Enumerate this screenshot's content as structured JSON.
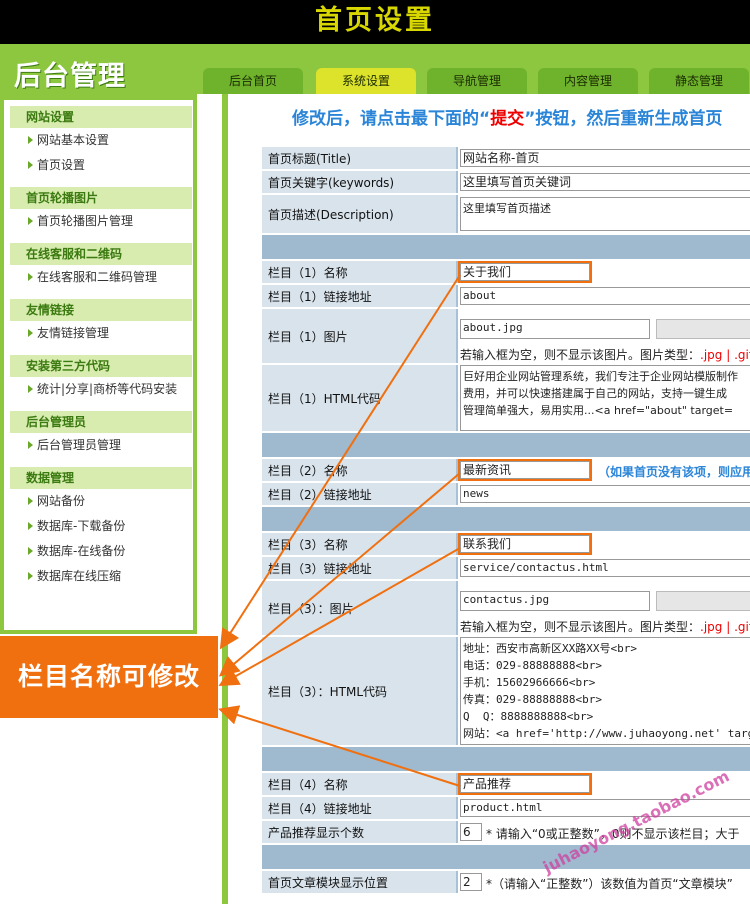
{
  "banner": "首页设置",
  "logo": "后台管理",
  "tabs": [
    "后台首页",
    "系统设置",
    "导航管理",
    "内容管理",
    "静态管理"
  ],
  "sidebar": {
    "g1": "网站设置",
    "g1i1": "网站基本设置",
    "g1i2": "首页设置",
    "g2": "首页轮播图片",
    "g2i1": "首页轮播图片管理",
    "g3": "在线客服和二维码",
    "g3i1": "在线客服和二维码管理",
    "g4": "友情链接",
    "g4i1": "友情链接管理",
    "g5": "安装第三方代码",
    "g5i1": "统计|分享|商桥等代码安装",
    "g6": "后台管理员",
    "g6i1": "后台管理员管理",
    "g7": "数据管理",
    "g7i1": "网站备份",
    "g7i2": "数据库-下载备份",
    "g7i3": "数据库-在线备份",
    "g7i4": "数据库在线压缩"
  },
  "callout": "栏目名称可修改",
  "notice": {
    "a": "修改后，请点击最下面的“",
    "b": "提交",
    "c": "”按钮，然后重新生成首页"
  },
  "form": {
    "title_l": "首页标题(Title)",
    "title_v": "网站名称-首页",
    "kw_l": "首页关键字(keywords)",
    "kw_v": "这里填写首页关键词",
    "desc_l": "首页描述(Description)",
    "desc_v": "这里填写首页描述",
    "c1n_l": "栏目（1）名称",
    "c1n_v": "关于我们",
    "c1u_l": "栏目（1）链接地址",
    "c1u_v": "about",
    "c1p_l": "栏目（1）图片",
    "c1p_v": "about.jpg",
    "imghint_a": "若输入框为空，则不显示该图片。图片类型：",
    "imghint_b": ".jpg | .gif",
    "c1h_l": "栏目（1）HTML代码",
    "c1h_v": "巨好用企业网站管理系统，我们专注于企业网站模版制作\n费用，并可以快速搭建属于自己的网站，支持一键生成\n管理简单强大，易用实用...<a href=\"about\" target=",
    "c2n_l": "栏目（2）名称",
    "c2n_v": "最新资讯",
    "c2n_hint": "（如果首页没有该项，则应用",
    "c2u_l": "栏目（2）链接地址",
    "c2u_v": "news",
    "c3n_l": "栏目（3）名称",
    "c3n_v": "联系我们",
    "c3u_l": "栏目（3）链接地址",
    "c3u_v": "service/contactus.html",
    "c3p_l": "栏目（3）：图片",
    "c3p_v": "contactus.jpg",
    "c3h_l": "栏目（3）：HTML代码",
    "c3h_v": "地址：西安市高新区XX路XX号<br>\n电话：029-88888888<br>\n手机：15602966666<br>\n传真：029-88888888<br>\nQ  Q：8888888888<br>\n网站：<a href='http://www.juhaoyong.net' target=",
    "c4n_l": "栏目（4）名称",
    "c4n_v": "产品推荐",
    "c4u_l": "栏目（4）链接地址",
    "c4u_v": "product.html",
    "cnt_l": "产品推荐显示个数",
    "cnt_v": "6",
    "cnt_hint": "* 请输入“0或正整数”，0则不显示该栏目；大于",
    "pos_l": "首页文章模块显示位置",
    "pos_v": "2",
    "pos_hint": "*（请输入“正整数”）该数值为首页“文章模块”"
  },
  "watermark": "juhaoyong.taobao.com"
}
